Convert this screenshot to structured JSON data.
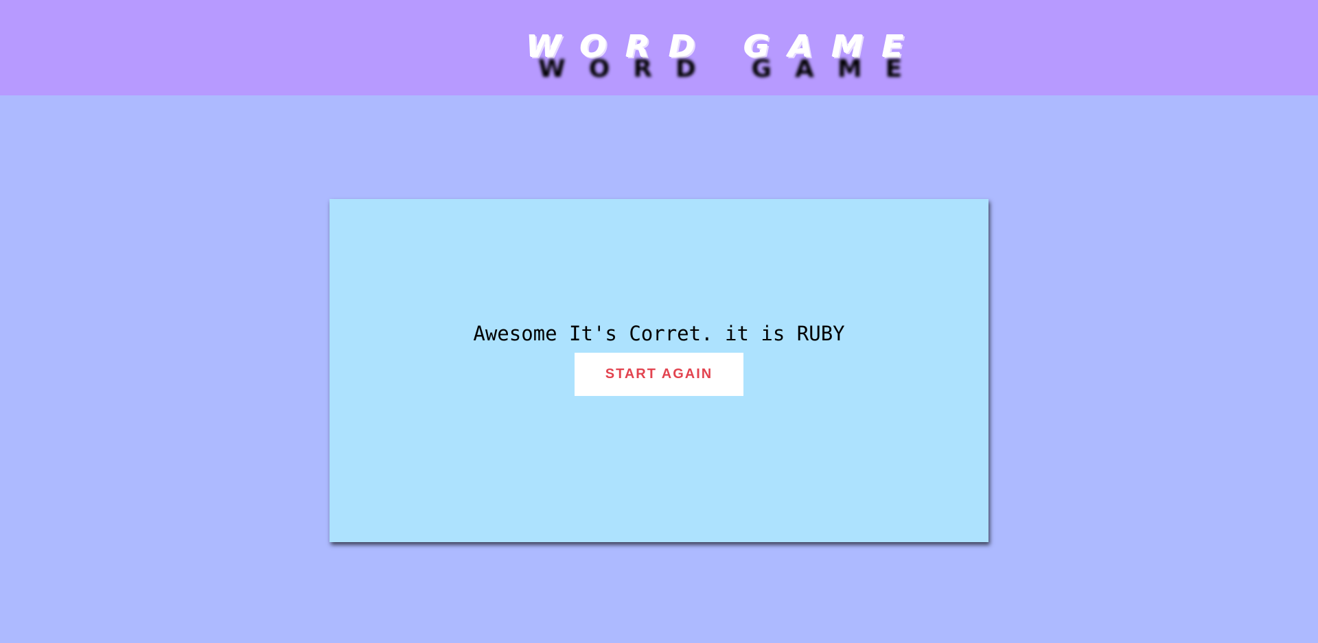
{
  "header": {
    "title": "WORD GAME"
  },
  "result": {
    "message": "Awesome It's Corret. it is RUBY",
    "button_label": "START AGAIN"
  },
  "colors": {
    "header_background": "#b79aff",
    "page_background": "#adbaff",
    "card_background": "#ade2fe",
    "button_text": "#e2434f"
  }
}
